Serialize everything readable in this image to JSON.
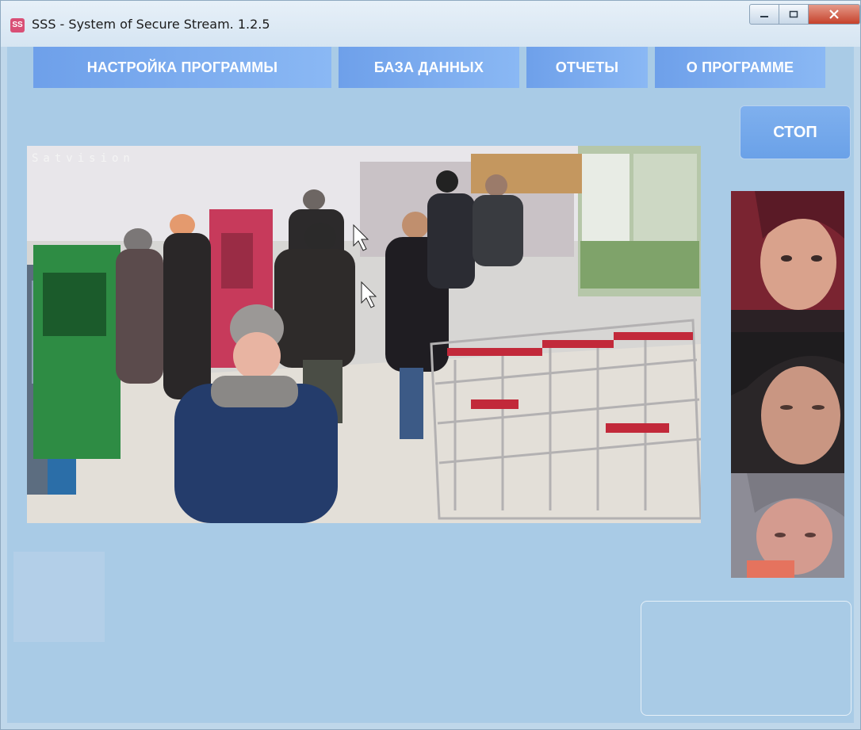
{
  "window": {
    "title": "SSS - System of Secure Stream. 1.2.5",
    "icon": "sss-app-icon",
    "controls": [
      "minimize-icon",
      "maximize-icon",
      "close-icon"
    ]
  },
  "menu": {
    "items": [
      {
        "label": "НАСТРОЙКА ПРОГРАММЫ"
      },
      {
        "label": "БАЗА ДАННЫХ"
      },
      {
        "label": "ОТЧЕТЫ"
      },
      {
        "label": "О ПРОГРАММЕ"
      }
    ]
  },
  "controls": {
    "stop_label": "СТОП"
  },
  "video": {
    "overlay_label": "Satvision"
  },
  "colors": {
    "client_bg": "#a9cbe6",
    "menu_button": "#7aa9ee",
    "stop_button": "#72a6ea",
    "title_bar": "#dde9f4",
    "close_button": "#c6412b"
  }
}
